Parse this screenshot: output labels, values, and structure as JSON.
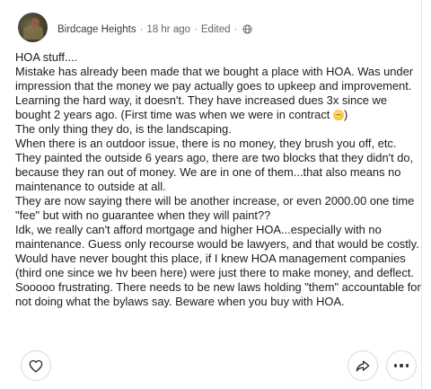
{
  "post": {
    "author": "Birdcage Heights",
    "time_ago": "18 hr ago",
    "edited": "Edited",
    "meta_separator": "·",
    "avatar_icon": "avatar-image",
    "visibility_icon": "globe-icon",
    "paragraphs": [
      "HOA stuff....",
      "Mistake has already been made that we bought a place with HOA. Was under impression that the money we pay actually goes to upkeep and improvement. Learning the hard way, it doesn't. They have increased dues 3x since we bought 2 years ago. (First time was when we were in contract ",
      "The only thing they do, is the landscaping.",
      "When there is an outdoor issue, there is no money, they brush you off, etc. They painted the outside 6 years ago, there are two blocks that they didn't do, because they ran out of money. We are in one of them...that also means no maintenance to outside at all.",
      "They are now saying there will be another increase, or even 2000.00 one time \"fee\" but with no guarantee when they will paint??",
      "Idk, we really can't afford mortgage and higher HOA...especially with no maintenance.  Guess only recourse would be lawyers, and that would be costly.  Would have never bought this place, if I knew HOA management companies (third one since we hv been here) were just there to make money, and deflect.",
      "Sooooo frustrating.  There needs to be new laws holding \"them\" accountable for not doing what the bylaws say. Beware when you buy with HOA."
    ],
    "paragraph_2_suffix": ")"
  },
  "actions": {
    "like_icon": "heart-icon",
    "share_icon": "share-arrow-icon",
    "more_icon": "more-horizontal-icon"
  }
}
